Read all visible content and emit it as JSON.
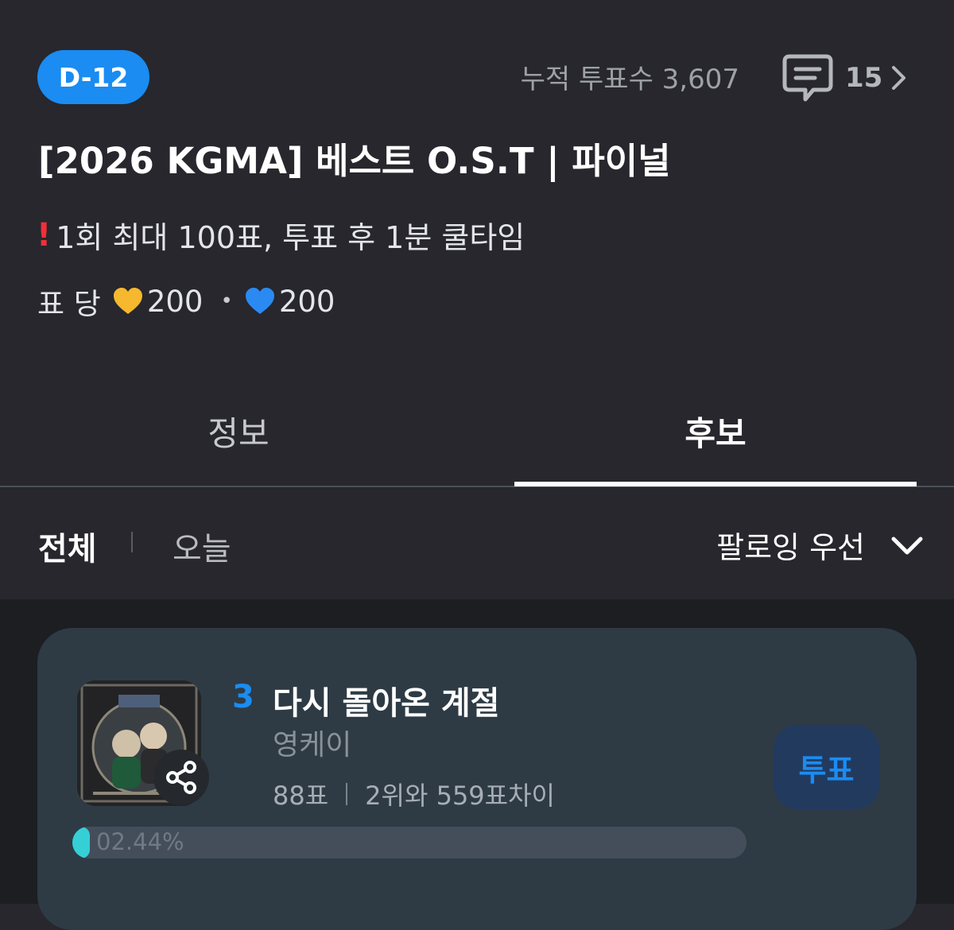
{
  "header": {
    "dday": "D-12",
    "total_votes": "누적 투표수 3,607",
    "comment_count": "15",
    "title": "[2026 KGMA] 베스트 O.S.T | 파이널",
    "notice": "1회 최대 100표, 투표 후 1분 쿨타임",
    "notice_icon": "exclamation-icon",
    "price_label": "표 당",
    "price_gold": "200",
    "price_blue": "200",
    "price_separator": "•"
  },
  "tabs": [
    {
      "label": "정보",
      "active": false
    },
    {
      "label": "후보",
      "active": true
    }
  ],
  "filters": {
    "all": "전체",
    "today": "오늘",
    "sort": "팔로잉 우선"
  },
  "candidates": [
    {
      "rank": "3",
      "song": "다시 돌아온 계절",
      "artist": "영케이",
      "votes": "88표",
      "gap": "2위와 559표차이",
      "vote_button": "투표",
      "percent_text": "02.44%",
      "percent": 2.44
    }
  ],
  "colors": {
    "accent": "#1a8cf2",
    "progress": "#34d0d6",
    "gold_heart": "#f5b82e",
    "blue_heart": "#2a8af2"
  }
}
